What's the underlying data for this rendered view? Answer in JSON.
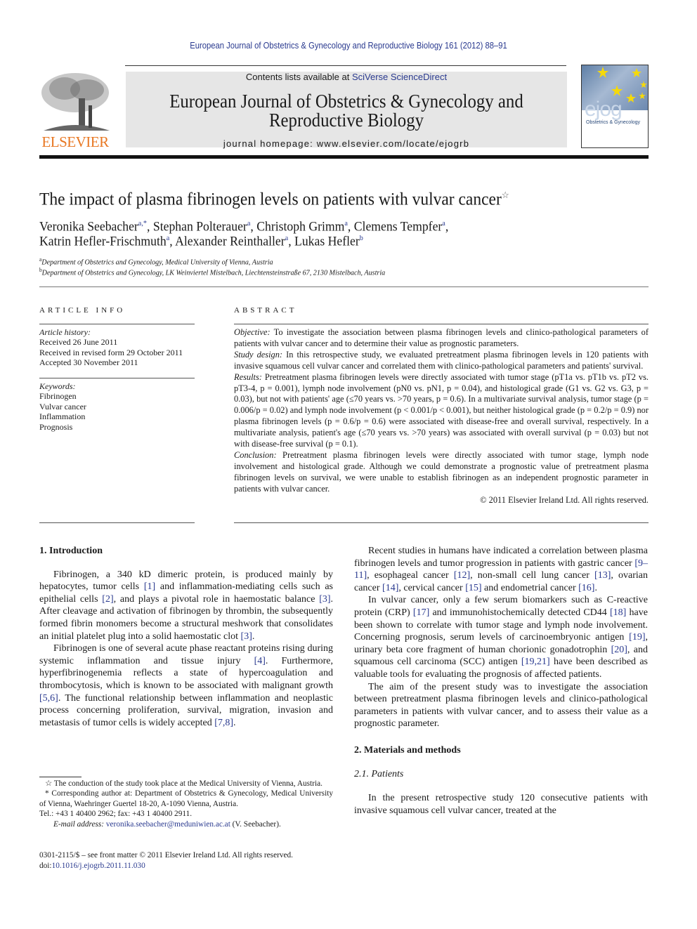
{
  "citation": "European Journal of Obstetrics & Gynecology and Reproductive Biology 161 (2012) 88–91",
  "header": {
    "publisher_logo_text": "ELSEVIER",
    "contents_prefix": "Contents lists available at ",
    "contents_link": "SciVerse ScienceDirect",
    "journal_title_line1": "European Journal of Obstetrics & Gynecology and",
    "journal_title_line2": "Reproductive Biology",
    "homepage_label": "journal homepage: ",
    "homepage_url": "www.elsevier.com/locate/ejogrb",
    "cover_logo": "ejog",
    "cover_subtitle": "Obstetrics & Gynecology"
  },
  "article": {
    "title": "The impact of plasma fibrinogen levels on patients with vulvar cancer",
    "title_mark": "☆",
    "authors_line1": [
      {
        "name": "Veronika Seebacher",
        "sup": "a,*",
        "sep": ", "
      },
      {
        "name": "Stephan Polterauer",
        "sup": "a",
        "sep": ", "
      },
      {
        "name": "Christoph Grimm",
        "sup": "a",
        "sep": ", "
      },
      {
        "name": "Clemens Tempfer",
        "sup": "a",
        "sep": ","
      }
    ],
    "authors_line2": [
      {
        "name": "Katrin Hefler-Frischmuth",
        "sup": "a",
        "sep": ", "
      },
      {
        "name": "Alexander Reinthaller",
        "sup": "a",
        "sep": ", "
      },
      {
        "name": "Lukas Hefler",
        "sup": "b",
        "sep": ""
      }
    ],
    "affiliations": [
      {
        "sup": "a",
        "text": "Department of Obstetrics and Gynecology, Medical University of Vienna, Austria"
      },
      {
        "sup": "b",
        "text": "Department of Obstetrics and Gynecology, LK Weinviertel Mistelbach, Liechtensteinstraße 67, 2130 Mistelbach, Austria"
      }
    ]
  },
  "article_info": {
    "heading": "ARTICLE INFO",
    "history_label": "Article history:",
    "history": [
      "Received 26 June 2011",
      "Received in revised form 29 October 2011",
      "Accepted 30 November 2011"
    ],
    "keywords_label": "Keywords:",
    "keywords": [
      "Fibrinogen",
      "Vulvar cancer",
      "Inflammation",
      "Prognosis"
    ]
  },
  "abstract": {
    "heading": "ABSTRACT",
    "sections": [
      {
        "label": "Objective:",
        "text": " To investigate the association between plasma fibrinogen levels and clinico-pathological parameters of patients with vulvar cancer and to determine their value as prognostic parameters."
      },
      {
        "label": "Study design:",
        "text": " In this retrospective study, we evaluated pretreatment plasma fibrinogen levels in 120 patients with invasive squamous cell vulvar cancer and correlated them with clinico-pathological parameters and patients' survival."
      },
      {
        "label": "Results:",
        "text": " Pretreatment plasma fibrinogen levels were directly associated with tumor stage (pT1a vs. pT1b vs. pT2 vs. pT3-4, p = 0.001), lymph node involvement (pN0 vs. pN1, p = 0.04), and histological grade (G1 vs. G2 vs. G3, p = 0.03), but not with patients' age (≤70 years vs. >70 years, p = 0.6). In a multivariate survival analysis, tumor stage (p = 0.006/p = 0.02) and lymph node involvement (p < 0.001/p < 0.001), but neither histological grade (p = 0.2/p = 0.9) nor plasma fibrinogen levels (p = 0.6/p = 0.6) were associated with disease-free and overall survival, respectively. In a multivariate analysis, patient's age (≤70 years vs. >70 years) was associated with overall survival (p = 0.03) but not with disease-free survival (p = 0.1)."
      },
      {
        "label": "Conclusion:",
        "text": " Pretreatment plasma fibrinogen levels were directly associated with tumor stage, lymph node involvement and histological grade. Although we could demonstrate a prognostic value of pretreatment plasma fibrinogen levels on survival, we were unable to establish fibrinogen as an independent prognostic parameter in patients with vulvar cancer."
      }
    ],
    "copyright": "© 2011 Elsevier Ireland Ltd. All rights reserved."
  },
  "body": {
    "intro_heading": "1.  Introduction",
    "intro_p1": [
      {
        "t": "Fibrinogen, a 340 kD dimeric protein, is produced mainly by hepatocytes, tumor cells "
      },
      {
        "c": "[1]"
      },
      {
        "t": " and inflammation-mediating cells such as epithelial cells "
      },
      {
        "c": "[2]"
      },
      {
        "t": ", and plays a pivotal role in haemostatic balance "
      },
      {
        "c": "[3]"
      },
      {
        "t": ". After cleavage and activation of fibrinogen by thrombin, the subsequently formed fibrin monomers become a structural meshwork that consolidates an initial platelet plug into a solid haemostatic clot "
      },
      {
        "c": "[3]"
      },
      {
        "t": "."
      }
    ],
    "intro_p2": [
      {
        "t": "Fibrinogen is one of several acute phase reactant proteins rising during systemic inflammation and tissue injury "
      },
      {
        "c": "[4]"
      },
      {
        "t": ". Furthermore, hyperfibrinogenemia reflects a state of hypercoagulation and thrombocytosis, which is known to be associated with malignant growth "
      },
      {
        "c": "[5,6]"
      },
      {
        "t": ". The functional relationship between inflammation and neoplastic process concerning proliferation, survival, migration, invasion and metastasis of tumor cells is widely accepted "
      },
      {
        "c": "[7,8]"
      },
      {
        "t": "."
      }
    ],
    "intro_p3": [
      {
        "t": "Recent studies in humans have indicated a correlation between plasma fibrinogen levels and tumor progression in patients with gastric cancer "
      },
      {
        "c": "[9–11]"
      },
      {
        "t": ", esophageal cancer "
      },
      {
        "c": "[12]"
      },
      {
        "t": ", non-small cell lung cancer "
      },
      {
        "c": "[13]"
      },
      {
        "t": ", ovarian cancer "
      },
      {
        "c": "[14]"
      },
      {
        "t": ", cervical cancer "
      },
      {
        "c": "[15]"
      },
      {
        "t": " and endometrial cancer "
      },
      {
        "c": "[16]"
      },
      {
        "t": "."
      }
    ],
    "intro_p4": [
      {
        "t": "In vulvar cancer, only a few serum biomarkers such as C-reactive protein (CRP) "
      },
      {
        "c": "[17]"
      },
      {
        "t": " and immunohistochemically detected CD44 "
      },
      {
        "c": "[18]"
      },
      {
        "t": " have been shown to correlate with tumor stage and lymph node involvement. Concerning prognosis, serum levels of carcinoembryonic antigen "
      },
      {
        "c": "[19]"
      },
      {
        "t": ", urinary beta core fragment of human chorionic gonadotrophin "
      },
      {
        "c": "[20]"
      },
      {
        "t": ", and squamous cell carcinoma (SCC) antigen "
      },
      {
        "c": "[19,21]"
      },
      {
        "t": " have been described as valuable tools for evaluating the prognosis of affected patients."
      }
    ],
    "intro_p5": [
      {
        "t": "The aim of the present study was to investigate the association between pretreatment plasma fibrinogen levels and clinico-pathological parameters in patients with vulvar cancer, and to assess their value as a prognostic parameter."
      }
    ],
    "methods_heading": "2.  Materials and methods",
    "patients_heading": "2.1.  Patients",
    "patients_p1": [
      {
        "t": "In the present retrospective study 120 consecutive patients with invasive squamous cell vulvar cancer, treated at the"
      }
    ]
  },
  "footnotes": {
    "star_note": "☆ The conduction of the study took place at the Medical University of Vienna, Austria.",
    "corresponding": "* Corresponding author at: Department of Obstetrics & Gynecology, Medical University of Vienna, Waehringer Guertel 18-20, A-1090 Vienna, Austria.",
    "tel": "Tel.: +43 1 40400 2962; fax: +43 1 40400 2911.",
    "email_label": "E-mail address: ",
    "email": "veronika.seebacher@meduniwien.ac.at",
    "email_suffix": " (V. Seebacher).",
    "front_matter": "0301-2115/$ – see front matter © 2011 Elsevier Ireland Ltd. All rights reserved.",
    "doi_label": "doi:",
    "doi": "10.1016/j.ejogrb.2011.11.030"
  },
  "colors": {
    "link": "#2a3a8f",
    "elsevier_orange": "#e87722",
    "banner_gray": "#e6e6e6"
  }
}
